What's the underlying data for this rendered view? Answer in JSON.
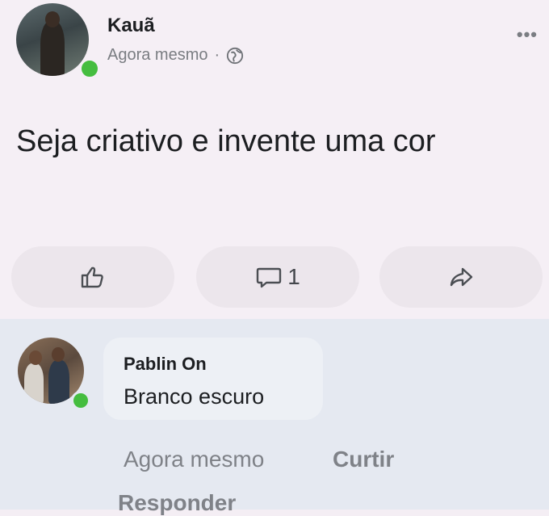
{
  "post": {
    "author": "Kauã",
    "time": "Agora mesmo",
    "separator": "·",
    "text": "Seja criativo e invente uma cor",
    "actions": {
      "like_icon": "thumbs-up-icon",
      "comment_icon": "comment-icon",
      "comment_count": "1",
      "share_icon": "share-icon"
    }
  },
  "comment": {
    "author": "Pablin On",
    "text": "Branco escuro",
    "time": "Agora mesmo",
    "like_label": "Curtir",
    "reply_label": "Responder"
  },
  "colors": {
    "online": "#45bd3f",
    "post_bg": "#f5eff5",
    "comments_bg": "#e5e9f1"
  }
}
